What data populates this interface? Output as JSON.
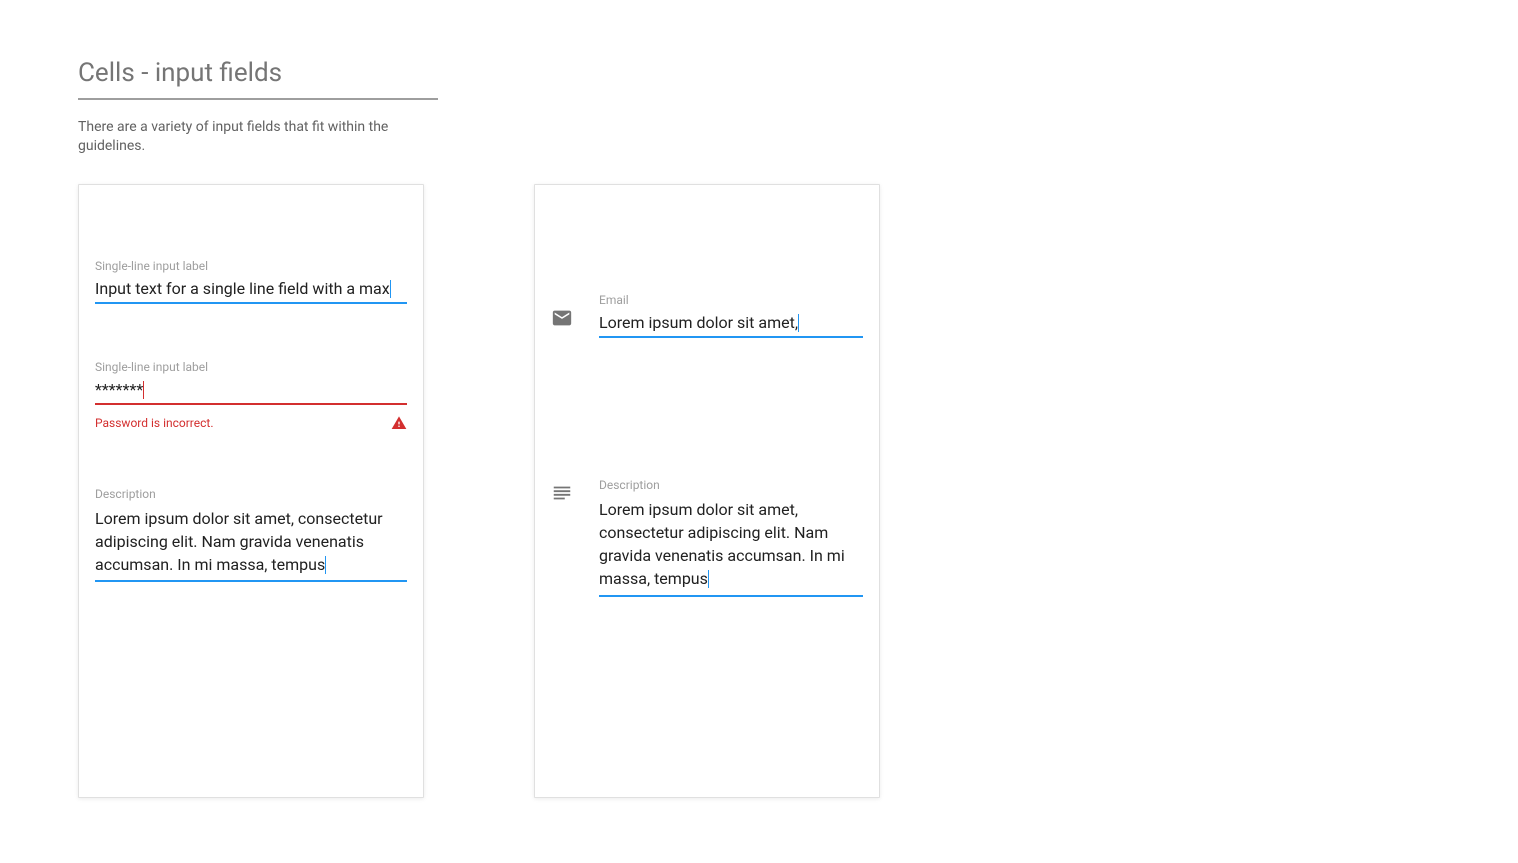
{
  "page": {
    "title": "Cells - input fields",
    "subtitle": "There are a variety of input fields that fit within the guidelines."
  },
  "card_left": {
    "field1": {
      "label": "Single-line input label",
      "value": "Input text for a single line field with a max"
    },
    "field2": {
      "label": "Single-line input label",
      "value": "*******",
      "error": "Password is incorrect."
    },
    "field3": {
      "label": "Description",
      "value": "Lorem ipsum dolor sit amet, consectetur adipiscing elit. Nam gravida venenatis accumsan. In mi massa, tempus"
    }
  },
  "card_right": {
    "field1": {
      "label": "Email",
      "value": "Lorem ipsum dolor sit amet,",
      "icon": "email-icon"
    },
    "field2": {
      "label": "Description",
      "value": "Lorem ipsum dolor sit amet, consectetur adipiscing elit. Nam gravida venenatis accumsan. In mi massa, tempus",
      "icon": "text-lines-icon"
    }
  },
  "colors": {
    "accent": "#2196f3",
    "error": "#d32f2f",
    "label": "#9e9e9e",
    "text": "#212121",
    "subtitle": "#616161"
  }
}
